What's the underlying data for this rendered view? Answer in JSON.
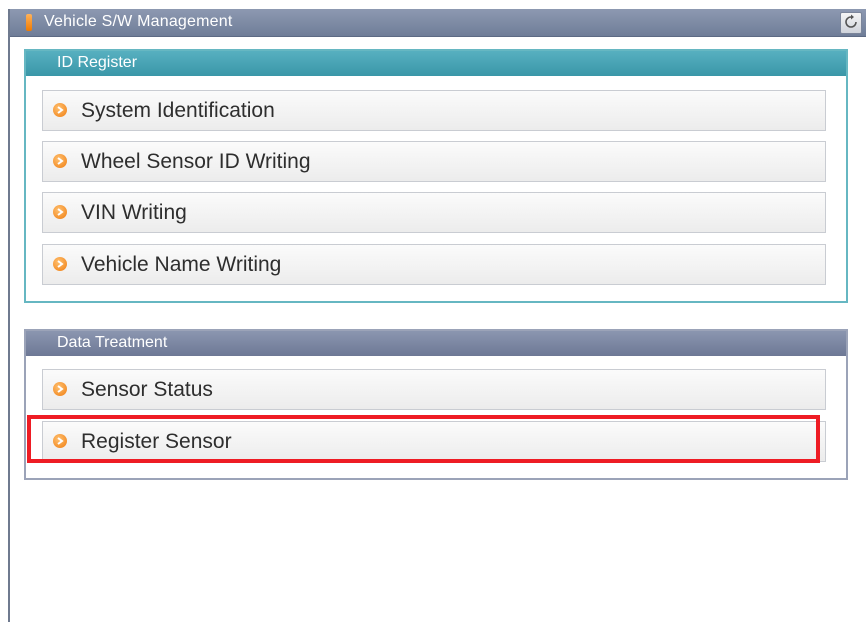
{
  "window": {
    "title": "Vehicle S/W Management",
    "retry_label": "Retry"
  },
  "id_register": {
    "header": "ID Register",
    "items": [
      {
        "label": "System Identification"
      },
      {
        "label": "Wheel Sensor ID Writing"
      },
      {
        "label": "VIN Writing"
      },
      {
        "label": "Vehicle Name Writing"
      }
    ]
  },
  "data_treatment": {
    "header": "Data Treatment",
    "items": [
      {
        "label": "Sensor Status"
      },
      {
        "label": "Register Sensor"
      }
    ]
  },
  "colors": {
    "highlight": "#ee1c24",
    "id_header": "#3a97a8",
    "data_header": "#6d7895",
    "arrow": "#ef7d10"
  },
  "icons": {
    "menu_item": "circle-arrow-right-icon",
    "title": "orange-marker-icon",
    "retry": "retry-icon"
  }
}
